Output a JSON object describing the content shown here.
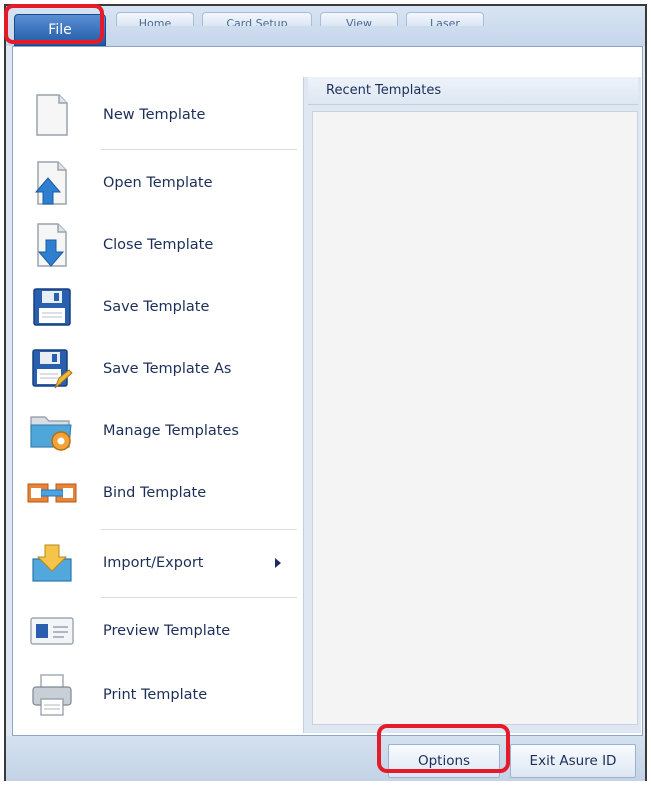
{
  "tabs": {
    "file": "File",
    "home": "Home",
    "card_setup": "Card Setup",
    "view": "View",
    "laser": "Laser"
  },
  "menu": {
    "items": [
      {
        "label": "New Template",
        "icon": "new-document-icon"
      },
      {
        "label": "Open Template",
        "icon": "open-template-icon"
      },
      {
        "label": "Close Template",
        "icon": "close-template-icon"
      },
      {
        "label": "Save Template",
        "icon": "save-disk-icon"
      },
      {
        "label": "Save Template As",
        "icon": "save-as-icon"
      },
      {
        "label": "Manage Templates",
        "icon": "manage-templates-icon"
      },
      {
        "label": "Bind Template",
        "icon": "bind-template-icon"
      },
      {
        "label": "Import/Export",
        "icon": "import-export-icon",
        "has_submenu": true
      },
      {
        "label": "Preview Template",
        "icon": "preview-card-icon"
      },
      {
        "label": "Print Template",
        "icon": "printer-icon"
      }
    ]
  },
  "recent": {
    "header": "Recent Templates"
  },
  "buttons": {
    "options": "Options",
    "exit": "Exit Asure ID"
  },
  "colors": {
    "highlight": "#e51b2a",
    "file_tab": "#1f5aa8",
    "label_text": "#1d2f59"
  }
}
